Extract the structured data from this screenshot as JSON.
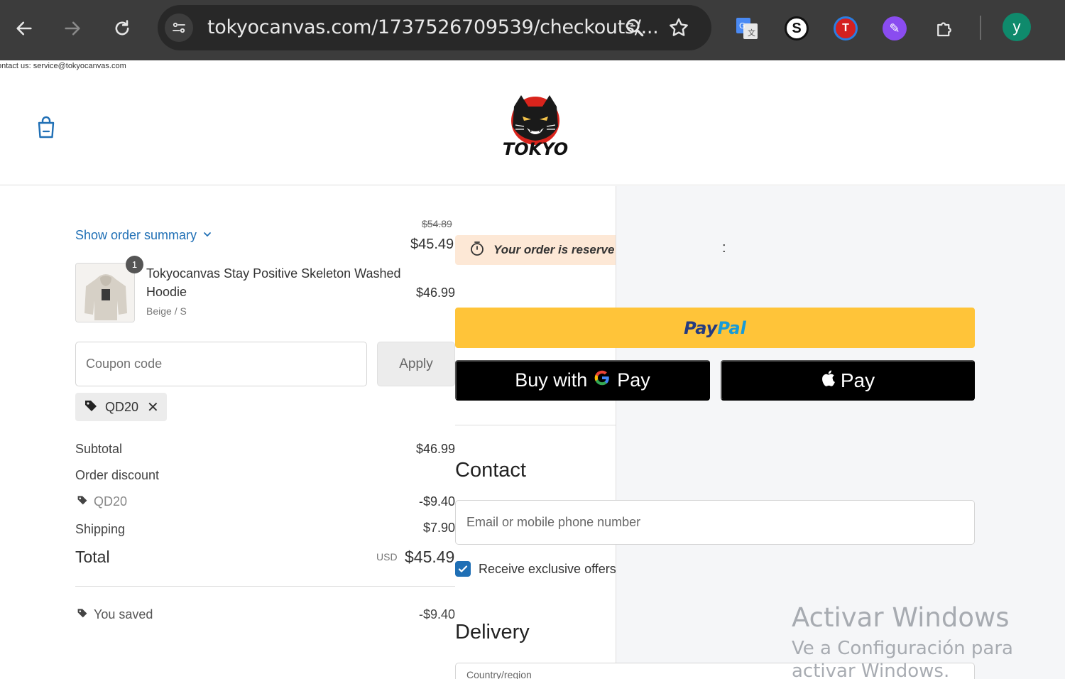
{
  "browser": {
    "url": "tokyocanvas.com/1737526709539/checkouts/...",
    "profile_initial": "y",
    "colors": {
      "chrome_bg": "#3c3c3c",
      "omnibox_bg": "#282828",
      "profile_bg": "#0f8a6c"
    },
    "icons": [
      "back-arrow-icon",
      "forward-arrow-icon",
      "reload-icon",
      "site-info-icon",
      "zoom-icon",
      "star-icon",
      "translate-extension-icon",
      "s-extension-icon",
      "t-extension-icon",
      "purple-extension-icon",
      "extensions-puzzle-icon"
    ]
  },
  "page": {
    "contact_line": "ontact us: service@tokyocanvas.com",
    "logo_text": "TOKYO"
  },
  "summary": {
    "toggle_label": "Show order summary",
    "compare_price": "$54.89",
    "top_total": "$45.49",
    "product": {
      "quantity": "1",
      "name": "Tokyocanvas Stay Positive Skeleton Washed Hoodie",
      "variant": "Beige / S",
      "price": "$46.99"
    },
    "coupon": {
      "placeholder": "Coupon code",
      "apply_label": "Apply",
      "applied_code": "QD20"
    },
    "rows": {
      "subtotal_label": "Subtotal",
      "subtotal_value": "$46.99",
      "discount_label": "Order discount",
      "discount_code": "QD20",
      "discount_value": "-$9.40",
      "shipping_label": "Shipping",
      "shipping_value": "$7.90",
      "total_label": "Total",
      "total_currency": "USD",
      "total_value": "$45.49",
      "saved_label": "You saved",
      "saved_value": "-$9.40"
    }
  },
  "checkout": {
    "reserve_text": "Your order is reserve",
    "colon": ":",
    "paypal_label": "PayPal",
    "gpay_prefix": "Buy with",
    "gpay_suffix": "Pay",
    "applepay_label": "Pay",
    "contact_heading": "Contact",
    "email_placeholder": "Email or mobile phone number",
    "offers_label": "Receive exclusive offers a",
    "delivery_heading": "Delivery",
    "country_label": "Country/region",
    "colors": {
      "paypal_yellow": "#ffc439",
      "accent_blue": "#1f6fb5",
      "reserve_bg": "#fde8d6"
    }
  },
  "watermark": {
    "title": "Activar Windows",
    "subtitle": "Ve a Configuración para activar Windows."
  }
}
